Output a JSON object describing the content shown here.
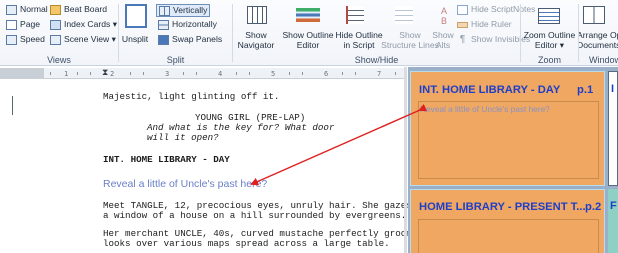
{
  "ribbon": {
    "views": {
      "label": "Views",
      "normal": "Normal",
      "page": "Page",
      "speed": "Speed",
      "beat_board": "Beat Board",
      "index_cards": "Index Cards ▾",
      "scene_view": "Scene View ▾"
    },
    "split": {
      "label": "Split",
      "unsplit": "Unsplit",
      "vertically": "Vertically",
      "horizontally": "Horizontally",
      "swap_panels": "Swap Panels"
    },
    "showhide": {
      "label": "Show/Hide",
      "show_navigator": [
        "Show",
        "Navigator"
      ],
      "show_outline_editor": [
        "Show Outline",
        "Editor"
      ],
      "hide_outline_in_script": [
        "Hide Outline",
        "in Script"
      ],
      "show_structure_lines": [
        "Show",
        "Structure Lines"
      ],
      "show_alts": [
        "Show",
        "Alts"
      ],
      "hide_scriptnotes": "Hide ScriptNotes",
      "hide_ruler": "Hide Ruler",
      "show_invisibles": "Show Invisibles"
    },
    "zoom": {
      "label": "Zoom",
      "zoom_outline_editor": [
        "Zoom Outline",
        "Editor ▾"
      ]
    },
    "window": {
      "label": "Window",
      "arrange_open_documents": [
        "Arrange Open",
        "Documents ▾"
      ]
    }
  },
  "ruler": {
    "marks": [
      "1",
      "2",
      "3",
      "4",
      "5",
      "6",
      "7"
    ]
  },
  "script": {
    "lines": [
      {
        "text": "Majestic, light glinting off it.",
        "style": "action"
      },
      {
        "text": "YOUNG GIRL (PRE-LAP)",
        "style": "character"
      },
      {
        "text": "And what is the key for? What door",
        "style": "dialogue"
      },
      {
        "text": "will it open?",
        "style": "dialogue"
      },
      {
        "text": "INT. HOME LIBRARY - DAY",
        "style": "heading"
      },
      {
        "text": "Meet TANGLE, 12, precocious eyes, unruly hair. She gazes",
        "style": "action"
      },
      {
        "text": "a window of a house on a hill surrounded by evergreens.",
        "style": "action"
      },
      {
        "text": "Her merchant UNCLE, 40s, curved mustache perfectly groom",
        "style": "action"
      },
      {
        "text": "looks over various maps spread across a large table.",
        "style": "action"
      }
    ],
    "note": "Reveal a little of Uncle's past here?"
  },
  "cards": [
    {
      "title": "INT. HOME LIBRARY - DAY",
      "page": "p.1",
      "body": "Reveal a little of Uncle's past here?"
    },
    {
      "title": "HOME LIBRARY - PRESENT T...",
      "page": "p.2",
      "body": ""
    }
  ],
  "side_cards": [
    {
      "letter": "I"
    },
    {
      "letter": "F"
    }
  ],
  "colors": {
    "card_bg": "#efa762",
    "card_title": "#1d3fc9",
    "note_text": "#6a7fc8",
    "arrow": "#e02020"
  }
}
